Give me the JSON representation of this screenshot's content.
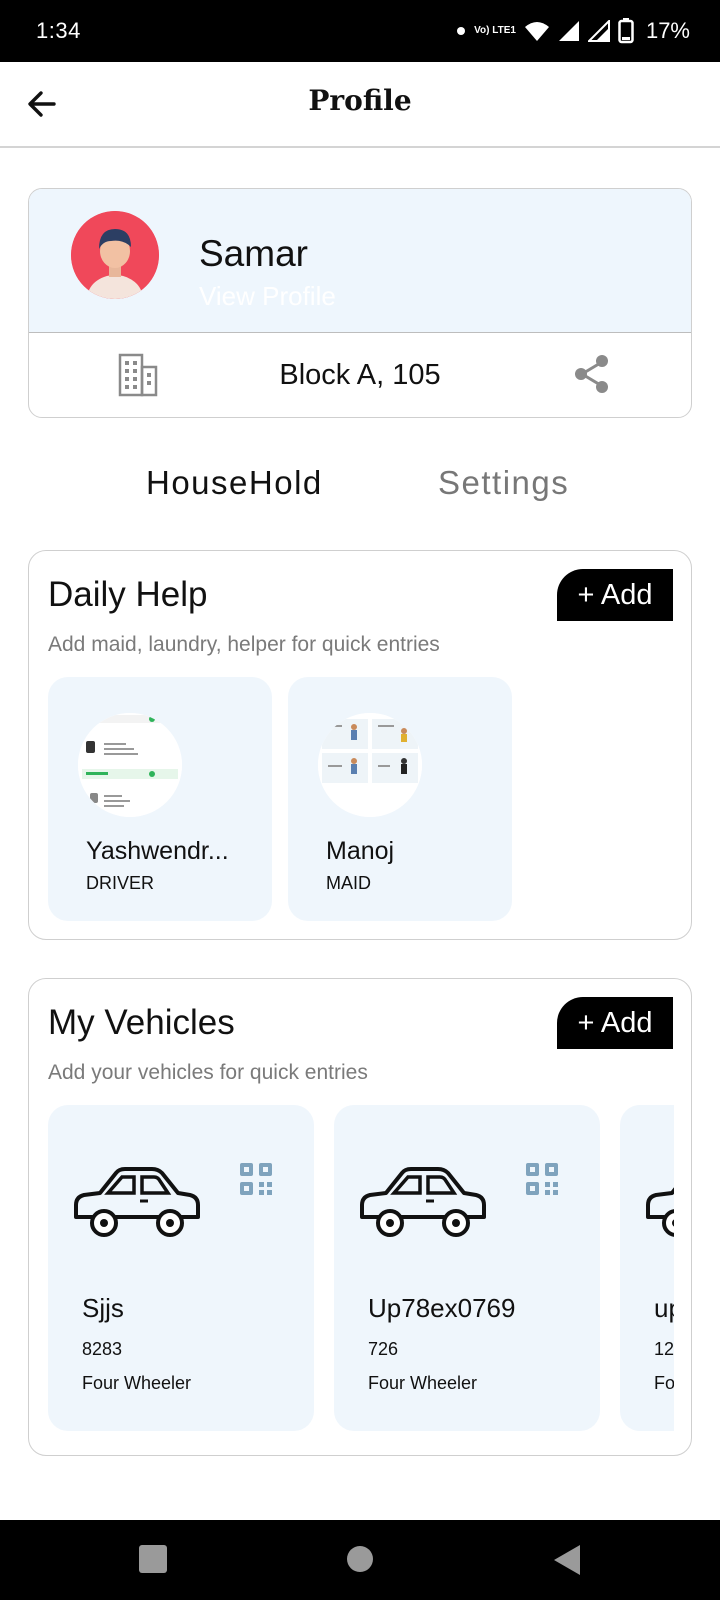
{
  "status_bar": {
    "time": "1:34",
    "network": "Vo) LTE1",
    "battery": "17%"
  },
  "app_bar": {
    "title": "Profile"
  },
  "profile": {
    "name": "Samar",
    "view_profile": "View Profile",
    "address": "Block A, 105"
  },
  "tabs": [
    {
      "label": "HouseHold",
      "active": true
    },
    {
      "label": "Settings",
      "active": false
    }
  ],
  "daily_help": {
    "title": "Daily Help",
    "subtitle": "Add maid, laundry, helper for quick entries",
    "add_label": "+ Add",
    "items": [
      {
        "name": "Yashwendr...",
        "role": "DRIVER"
      },
      {
        "name": "Manoj",
        "role": "MAID"
      }
    ]
  },
  "vehicles": {
    "title": "My Vehicles",
    "subtitle": "Add your vehicles for quick entries",
    "add_label": "+ Add",
    "items": [
      {
        "name": "Sjjs",
        "number": "8283",
        "type": "Four Wheeler"
      },
      {
        "name": "Up78ex0769",
        "number": "726",
        "type": "Four Wheeler"
      },
      {
        "name": "up",
        "number": "12",
        "type": "Fo"
      }
    ]
  },
  "colors": {
    "card_bg": "#eff6fc",
    "profile_bg": "#eef6fd",
    "avatar_bg": "#f0485a",
    "qr_color": "#7fa3bd",
    "inactive_tab": "#777777"
  }
}
